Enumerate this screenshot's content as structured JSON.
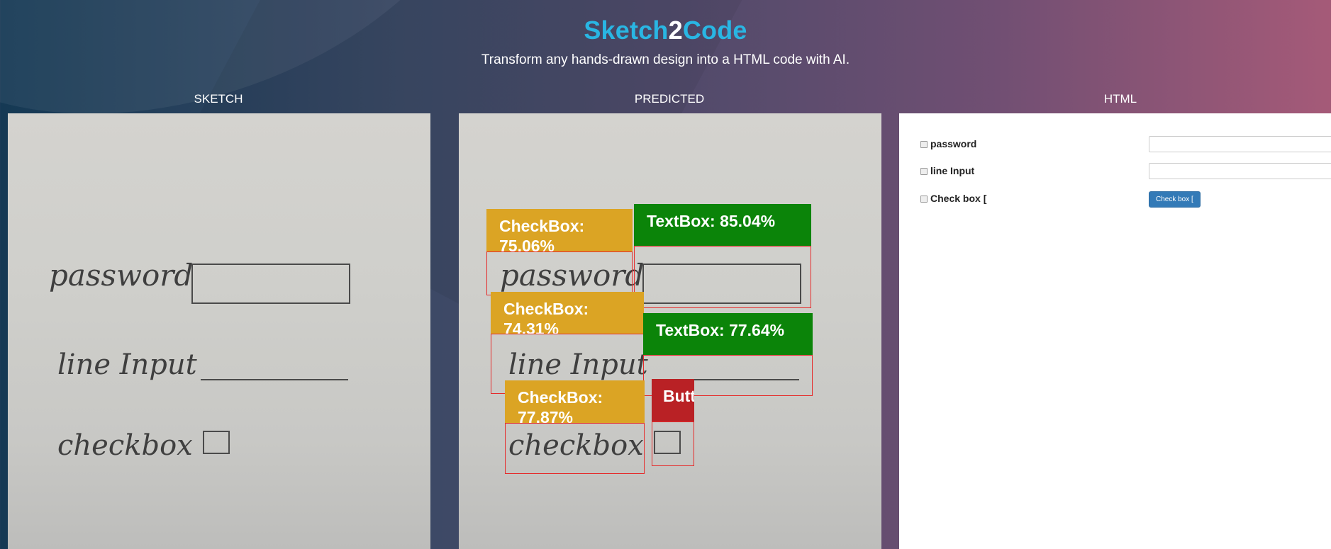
{
  "brand": {
    "part1": "Sketch",
    "part2": "2",
    "part3": "Code"
  },
  "tagline": "Transform any hands-drawn design into a HTML code with AI.",
  "columns": {
    "sketch": "SKETCH",
    "predicted": "PREDICTED",
    "html": "HTML"
  },
  "sketch": {
    "password": "password",
    "line_input": "line Input",
    "checkbox": "checkbox"
  },
  "predictions": [
    {
      "label": "CheckBox: 75.06%",
      "class": "CheckBox",
      "confidence": 75.06,
      "color": "#dba424"
    },
    {
      "label": "TextBox: 85.04%",
      "class": "TextBox",
      "confidence": 85.04,
      "color": "#0b8409"
    },
    {
      "label": "CheckBox: 74.31%",
      "class": "CheckBox",
      "confidence": 74.31,
      "color": "#dba424"
    },
    {
      "label": "TextBox: 77.64%",
      "class": "TextBox",
      "confidence": 77.64,
      "color": "#0b8409"
    },
    {
      "label": "CheckBox: 77.87%",
      "class": "CheckBox",
      "confidence": 77.87,
      "color": "#dba424"
    },
    {
      "label": "Button:",
      "class": "Button",
      "color": "#b92125"
    }
  ],
  "html_form": {
    "row1_label": "password",
    "row2_label": "line Input",
    "row3_label": "Check box [",
    "button_label": "Check box ["
  },
  "colors": {
    "brand_accent": "#29b6e3",
    "box_outline": "#e52b2b",
    "button": "#337ab7"
  }
}
